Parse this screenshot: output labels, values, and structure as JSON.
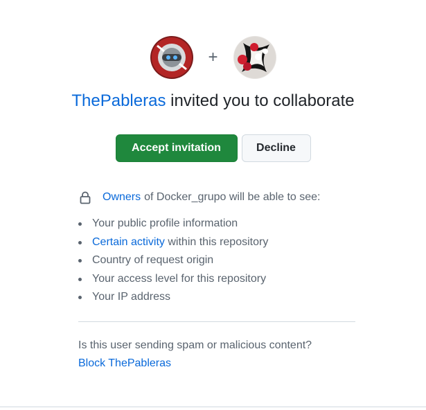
{
  "invitation": {
    "inviter": "ThePableras",
    "headline_suffix": "invited you to collaborate",
    "plus_sign": "+",
    "inviter_avatar_icon": "robot-avatar-icon",
    "repo_avatar_icon": "flowers-avatar-icon"
  },
  "actions": {
    "accept_label": "Accept invitation",
    "decline_label": "Decline"
  },
  "permissions": {
    "owners_link": "Owners",
    "intro": "of Docker_grupo will be able to see:",
    "items": [
      {
        "link": "",
        "text": "Your public profile information"
      },
      {
        "link": "Certain activity",
        "text": "within this repository"
      },
      {
        "link": "",
        "text": "Country of request origin"
      },
      {
        "link": "",
        "text": "Your access level for this repository"
      },
      {
        "link": "",
        "text": "Your IP address"
      }
    ]
  },
  "report": {
    "question": "Is this user sending spam or malicious content?",
    "block_link": "Block ThePableras"
  },
  "colors": {
    "link": "#0969da",
    "primary_button": "#1f883d",
    "muted_text": "#59636e"
  }
}
